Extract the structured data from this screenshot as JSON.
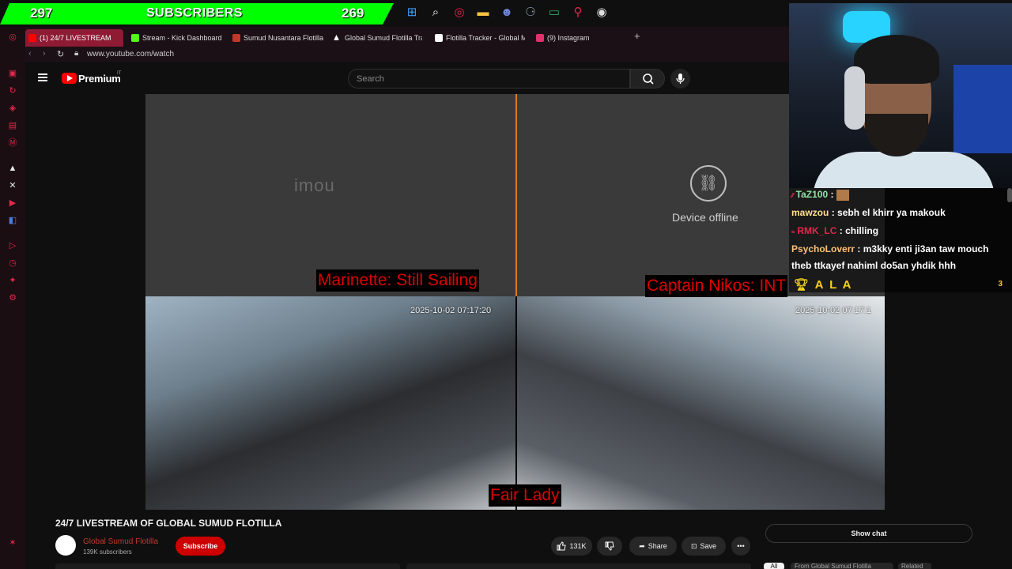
{
  "overlay": {
    "sub_left_count": "297",
    "sub_title": "SUBSCRIBERS",
    "sub_right_count": "269"
  },
  "taskbar": [
    "windows-icon",
    "search-icon",
    "opera-icon",
    "folder-icon",
    "discord-icon",
    "steam-icon",
    "terminal-icon",
    "maps-icon",
    "obs-icon"
  ],
  "tabs": [
    {
      "label": "(1) 24/7 LIVESTREAM",
      "color": "#ff0000",
      "active": true
    },
    {
      "label": "Stream - Kick Dashboard",
      "color": "#53fc18",
      "active": false
    },
    {
      "label": "Sumud Nusantara Flotilla",
      "color": "#c0392b",
      "active": false
    },
    {
      "label": "Global Sumud Flotilla Trac",
      "color": "#ffffff",
      "active": false
    },
    {
      "label": "Flotilla Tracker - Global M",
      "color": "#ffffff",
      "active": false
    },
    {
      "label": "(9) Instagram",
      "color": "#e1306c",
      "active": false
    }
  ],
  "address": {
    "url": "www.youtube.com/watch"
  },
  "youtube": {
    "logo_text": "Premium",
    "country_code": "IT",
    "search_placeholder": "Search"
  },
  "video": {
    "cam_tl_brand": "imou",
    "cam_tr_status": "Device offline",
    "ts_left": "2025-10-02 07:17:20",
    "ts_right": "2025-10-02 07:17:1",
    "label_marinette": "Marinette: Still Sailing",
    "label_nikos": "Captain Nikos: INT",
    "label_fairlady": "Fair Lady"
  },
  "info": {
    "title": "24/7 LIVESTREAM OF GLOBAL SUMUD FLOTILLA",
    "channel": "Global Sumud Flotilla",
    "subs": "139K subscribers",
    "subscribe": "Subscribe",
    "likes": "131K",
    "share": "Share",
    "save": "Save",
    "show_chat": "Show chat",
    "chips": [
      "All",
      "From Global Sumud Flotilla",
      "Related"
    ]
  },
  "chat": [
    {
      "user": "TaZ100",
      "user_color": "#8fe3a1",
      "msg": ":"
    },
    {
      "user": "mawzou",
      "user_color": "#ffe08a",
      "msg": ": sebh el khirr ya makouk"
    },
    {
      "user": "RMK_LC",
      "user_color": "#e0284a",
      "msg": ": chilling"
    },
    {
      "user": "PsychoLoverr",
      "user_color": "#ffc078",
      "msg": ": m3kky enti ji3an taw mouch"
    },
    {
      "user": "",
      "user_color": "#ffffff",
      "msg": "theb ttkayef nahiml do5an yhdik hhh"
    }
  ],
  "chat_ala": "A L A",
  "chat_ala_count": "3",
  "colors": {
    "accent_green": "#00ff00",
    "opera_red": "#e0284a",
    "yt_red": "#ff0000"
  }
}
